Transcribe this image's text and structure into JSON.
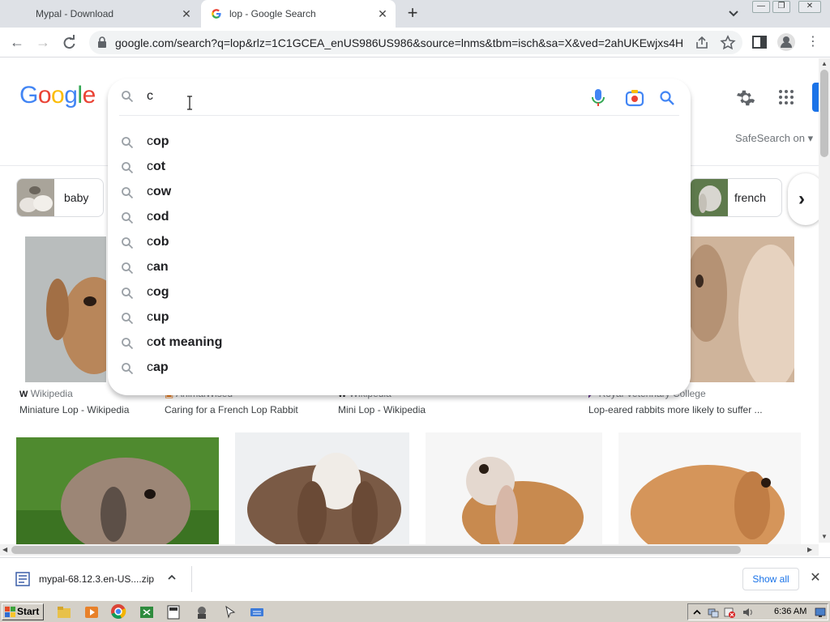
{
  "browser": {
    "tabs": [
      {
        "title": "Mypal - Download",
        "active": false
      },
      {
        "title": "lop - Google Search",
        "active": true
      }
    ],
    "url": "google.com/search?q=lop&rlz=1C1GCEA_enUS986US986&source=lnms&tbm=isch&sa=X&ved=2ahUKEwjxs4Ht..."
  },
  "google": {
    "logo_letters": [
      {
        "ch": "G",
        "color": "#4285F4"
      },
      {
        "ch": "o",
        "color": "#EA4335"
      },
      {
        "ch": "o",
        "color": "#FBBC05"
      },
      {
        "ch": "g",
        "color": "#4285F4"
      },
      {
        "ch": "l",
        "color": "#34A853"
      },
      {
        "ch": "e",
        "color": "#EA4335"
      }
    ],
    "safesearch_label": "SafeSearch on ▾",
    "search_value": "c"
  },
  "suggestions": [
    {
      "prefix": "c",
      "rest": "op"
    },
    {
      "prefix": "c",
      "rest": "ot"
    },
    {
      "prefix": "c",
      "rest": "ow"
    },
    {
      "prefix": "c",
      "rest": "od"
    },
    {
      "prefix": "c",
      "rest": "ob"
    },
    {
      "prefix": "c",
      "rest": "an"
    },
    {
      "prefix": "c",
      "rest": "og"
    },
    {
      "prefix": "c",
      "rest": "up"
    },
    {
      "prefix": "c",
      "rest": "ot meaning"
    },
    {
      "prefix": "c",
      "rest": "ap"
    }
  ],
  "chips": [
    {
      "label": "baby"
    },
    {
      "label": "french"
    }
  ],
  "results_row1": [
    {
      "source": "Wikipedia",
      "caption": "Miniature Lop - Wikipedia"
    },
    {
      "source": "AnimalWised",
      "caption": "Caring for a French Lop Rabbit"
    },
    {
      "source": "Wikipedia",
      "caption": "Mini Lop - Wikipedia"
    },
    {
      "source": "Royal Veterinary College",
      "caption": "Lop-eared rabbits more likely to suffer ..."
    }
  ],
  "downloads": {
    "filename": "mypal-68.12.3.en-US....zip",
    "show_all": "Show all"
  },
  "taskbar": {
    "start_label": "Start",
    "clock": "6:36 AM"
  },
  "colors": {
    "google_blue": "#1a73e8",
    "mic_blue": "#4285F4"
  }
}
